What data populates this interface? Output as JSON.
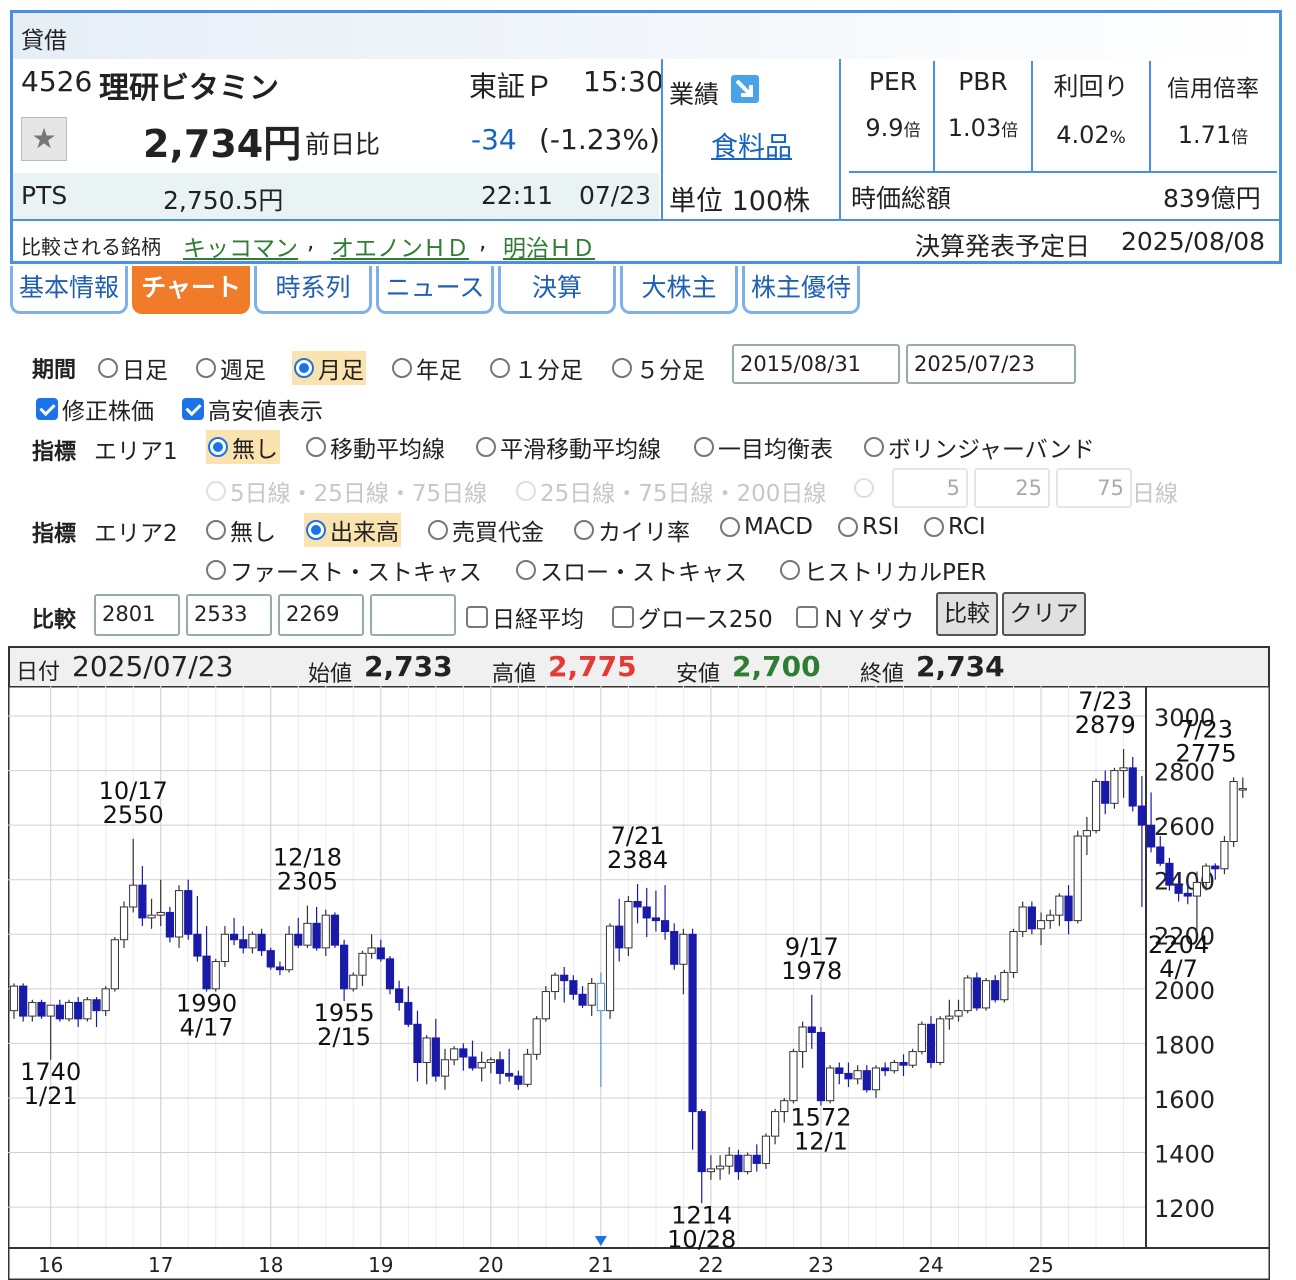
{
  "header": {
    "margin_label": "貸借",
    "code": "4526",
    "name": "理研ビタミン",
    "market": "東証Ｐ",
    "time": "15:30",
    "price": "2,734円",
    "change_label": "前日比",
    "change": "-34",
    "change_pct": "(-1.23%)",
    "pts_label": "PTS",
    "pts_price": "2,750.5円",
    "pts_time": "22:11",
    "pts_date": "07/23",
    "results_label": "業績",
    "sector": "食料品",
    "unit": "単位 100株",
    "metrics": [
      {
        "label": "PER",
        "value": "9.9",
        "unit": "倍"
      },
      {
        "label": "PBR",
        "value": "1.03",
        "unit": "倍"
      },
      {
        "label": "利回り",
        "value": "4.02",
        "unit": "%"
      },
      {
        "label": "信用倍率",
        "value": "1.71",
        "unit": "倍"
      }
    ],
    "market_cap_label": "時価総額",
    "market_cap": "839億円",
    "compare_label": "比較される銘柄",
    "compare_links": [
      "キッコマン",
      "オエノンＨＤ",
      "明治ＨＤ"
    ],
    "earnings_label": "決算発表予定日",
    "earnings_date": "2025/08/08"
  },
  "tabs": [
    "基本情報",
    "チャート",
    "時系列",
    "ニュース",
    "決算",
    "大株主",
    "株主優待"
  ],
  "active_tab": "チャート",
  "controls": {
    "period_label": "期間",
    "period_options": [
      "日足",
      "週足",
      "月足",
      "年足",
      "１分足",
      "５分足"
    ],
    "period_selected": "月足",
    "date_from": "2015/08/31",
    "date_to": "2025/07/23",
    "adjusted_label": "修正株価",
    "highlow_label": "高安値表示",
    "indicator_label": "指標",
    "area1_label": "エリア1",
    "area1_options": [
      "無し",
      "移動平均線",
      "平滑移動平均線",
      "一目均衡表",
      "ボリンジャーバンド"
    ],
    "area1_selected": "無し",
    "ma_options": [
      "5日線・25日線・75日線",
      "25日線・75日線・200日線"
    ],
    "ma_inputs": [
      "5",
      "25",
      "75"
    ],
    "ma_suffix": "日線",
    "area2_label": "エリア2",
    "area2_options": [
      "無し",
      "出来高",
      "売買代金",
      "カイリ率",
      "MACD",
      "RSI",
      "RCI",
      "ファースト・ストキャス",
      "スロー・ストキャス",
      "ヒストリカルPER"
    ],
    "area2_selected": "出来高",
    "compare_label": "比較",
    "compare_codes": [
      "2801",
      "2533",
      "2269",
      ""
    ],
    "compare_checks": [
      "日経平均",
      "グロース250",
      "ＮＹダウ"
    ],
    "compare_button": "比較",
    "clear_button": "クリア"
  },
  "ohlc_bar": {
    "date_label": "日付",
    "date": "2025/07/23",
    "open_label": "始値",
    "open": "2,733",
    "high_label": "高値",
    "high": "2,775",
    "low_label": "安値",
    "low": "2,700",
    "close_label": "終値",
    "close": "2,734"
  },
  "colors": {
    "up": "#ffffff",
    "down": "#1a1aa8",
    "high": "#e53935",
    "low": "#2e7d32",
    "accent": "#4a90e2",
    "tab_active": "#f07c2a"
  },
  "chart_data": {
    "type": "candlestick",
    "interval": "monthly",
    "ylim": [
      1050,
      3110
    ],
    "yticks": [
      1200,
      1400,
      1600,
      1800,
      2000,
      2200,
      2400,
      2600,
      2800,
      3000
    ],
    "xticks": [
      "16",
      "17",
      "18",
      "19",
      "20",
      "21",
      "22",
      "23",
      "24",
      "25"
    ],
    "year_start_index": 4,
    "candles": [
      [
        1920,
        2020,
        1890,
        2010
      ],
      [
        2010,
        2020,
        1880,
        1900
      ],
      [
        1900,
        1960,
        1880,
        1950
      ],
      [
        1950,
        1960,
        1890,
        1900
      ],
      [
        1900,
        1940,
        1740,
        1940
      ],
      [
        1940,
        1960,
        1880,
        1890
      ],
      [
        1890,
        1960,
        1880,
        1950
      ],
      [
        1950,
        1970,
        1860,
        1890
      ],
      [
        1890,
        1970,
        1880,
        1960
      ],
      [
        1960,
        1970,
        1860,
        1920
      ],
      [
        1920,
        2010,
        1900,
        2000
      ],
      [
        2000,
        2190,
        1990,
        2180
      ],
      [
        2180,
        2320,
        2150,
        2300
      ],
      [
        2300,
        2550,
        2280,
        2380
      ],
      [
        2380,
        2450,
        2230,
        2260
      ],
      [
        2260,
        2330,
        2220,
        2270
      ],
      [
        2270,
        2400,
        2230,
        2280
      ],
      [
        2280,
        2300,
        2170,
        2190
      ],
      [
        2190,
        2380,
        2150,
        2360
      ],
      [
        2360,
        2400,
        2180,
        2200
      ],
      [
        2200,
        2340,
        2100,
        2120
      ],
      [
        2120,
        2230,
        1990,
        2000
      ],
      [
        2000,
        2110,
        1990,
        2100
      ],
      [
        2100,
        2230,
        2080,
        2200
      ],
      [
        2200,
        2260,
        2160,
        2180
      ],
      [
        2180,
        2230,
        2130,
        2150
      ],
      [
        2150,
        2210,
        2130,
        2200
      ],
      [
        2200,
        2220,
        2120,
        2140
      ],
      [
        2140,
        2150,
        2070,
        2080
      ],
      [
        2080,
        2100,
        2050,
        2070
      ],
      [
        2070,
        2230,
        2060,
        2200
      ],
      [
        2200,
        2260,
        2150,
        2160
      ],
      [
        2160,
        2305,
        2150,
        2240
      ],
      [
        2240,
        2300,
        2140,
        2150
      ],
      [
        2150,
        2290,
        2120,
        2270
      ],
      [
        2270,
        2280,
        2150,
        2160
      ],
      [
        2160,
        2180,
        1955,
        2000
      ],
      [
        2000,
        2060,
        1990,
        2050
      ],
      [
        2050,
        2140,
        2010,
        2130
      ],
      [
        2130,
        2200,
        2110,
        2150
      ],
      [
        2150,
        2180,
        2100,
        2110
      ],
      [
        2110,
        2120,
        1980,
        2000
      ],
      [
        2000,
        2030,
        1920,
        1950
      ],
      [
        1950,
        2010,
        1860,
        1870
      ],
      [
        1870,
        1920,
        1660,
        1730
      ],
      [
        1730,
        1830,
        1650,
        1820
      ],
      [
        1820,
        1890,
        1660,
        1680
      ],
      [
        1680,
        1780,
        1630,
        1740
      ],
      [
        1740,
        1790,
        1720,
        1780
      ],
      [
        1780,
        1800,
        1700,
        1750
      ],
      [
        1750,
        1810,
        1700,
        1710
      ],
      [
        1710,
        1770,
        1660,
        1730
      ],
      [
        1730,
        1750,
        1690,
        1740
      ],
      [
        1740,
        1770,
        1650,
        1690
      ],
      [
        1690,
        1780,
        1660,
        1680
      ],
      [
        1680,
        1700,
        1630,
        1650
      ],
      [
        1650,
        1780,
        1640,
        1760
      ],
      [
        1760,
        1900,
        1740,
        1890
      ],
      [
        1890,
        2010,
        1880,
        1990
      ],
      [
        1990,
        2060,
        1960,
        2050
      ],
      [
        2050,
        2080,
        1950,
        2030
      ],
      [
        2030,
        2050,
        1960,
        1980
      ],
      [
        1980,
        2010,
        1930,
        1940
      ],
      [
        1940,
        2040,
        1900,
        2020
      ],
      [
        2020,
        2060,
        1640,
        1920
      ],
      [
        1920,
        2240,
        1890,
        2230
      ],
      [
        2230,
        2330,
        2100,
        2150
      ],
      [
        2150,
        2340,
        2120,
        2320
      ],
      [
        2320,
        2384,
        2240,
        2300
      ],
      [
        2300,
        2370,
        2190,
        2260
      ],
      [
        2260,
        2360,
        2210,
        2250
      ],
      [
        2250,
        2380,
        2180,
        2210
      ],
      [
        2210,
        2240,
        2070,
        2090
      ],
      [
        2090,
        2220,
        1980,
        2200
      ],
      [
        2200,
        2220,
        1410,
        1550
      ],
      [
        1550,
        1560,
        1214,
        1330
      ],
      [
        1330,
        1390,
        1300,
        1340
      ],
      [
        1340,
        1390,
        1300,
        1350
      ],
      [
        1350,
        1420,
        1320,
        1390
      ],
      [
        1390,
        1410,
        1300,
        1330
      ],
      [
        1330,
        1400,
        1320,
        1390
      ],
      [
        1390,
        1430,
        1330,
        1360
      ],
      [
        1360,
        1470,
        1340,
        1460
      ],
      [
        1460,
        1560,
        1430,
        1550
      ],
      [
        1550,
        1600,
        1510,
        1590
      ],
      [
        1590,
        1780,
        1580,
        1770
      ],
      [
        1770,
        1880,
        1710,
        1860
      ],
      [
        1860,
        1978,
        1780,
        1840
      ],
      [
        1840,
        1860,
        1572,
        1590
      ],
      [
        1590,
        1720,
        1580,
        1710
      ],
      [
        1710,
        1730,
        1650,
        1690
      ],
      [
        1690,
        1730,
        1640,
        1670
      ],
      [
        1670,
        1720,
        1650,
        1700
      ],
      [
        1700,
        1720,
        1620,
        1630
      ],
      [
        1630,
        1720,
        1600,
        1710
      ],
      [
        1710,
        1730,
        1680,
        1700
      ],
      [
        1700,
        1740,
        1690,
        1730
      ],
      [
        1730,
        1760,
        1680,
        1720
      ],
      [
        1720,
        1780,
        1710,
        1770
      ],
      [
        1770,
        1880,
        1760,
        1870
      ],
      [
        1870,
        1900,
        1710,
        1730
      ],
      [
        1730,
        1900,
        1720,
        1890
      ],
      [
        1890,
        1960,
        1850,
        1900
      ],
      [
        1900,
        1960,
        1880,
        1920
      ],
      [
        1920,
        2050,
        1910,
        2040
      ],
      [
        2040,
        2060,
        1920,
        1930
      ],
      [
        1930,
        2040,
        1920,
        2030
      ],
      [
        2030,
        2050,
        1950,
        1960
      ],
      [
        1960,
        2070,
        1950,
        2060
      ],
      [
        2060,
        2220,
        2040,
        2210
      ],
      [
        2210,
        2320,
        2190,
        2300
      ],
      [
        2300,
        2320,
        2200,
        2220
      ],
      [
        2220,
        2280,
        2160,
        2250
      ],
      [
        2250,
        2290,
        2220,
        2270
      ],
      [
        2270,
        2350,
        2230,
        2340
      ],
      [
        2340,
        2380,
        2200,
        2250
      ],
      [
        2250,
        2580,
        2240,
        2560
      ],
      [
        2560,
        2630,
        2490,
        2580
      ],
      [
        2580,
        2770,
        2570,
        2760
      ],
      [
        2760,
        2800,
        2640,
        2680
      ],
      [
        2680,
        2810,
        2660,
        2800
      ],
      [
        2800,
        2879,
        2700,
        2810
      ],
      [
        2810,
        2850,
        2650,
        2670
      ],
      [
        2670,
        2780,
        2300,
        2600
      ],
      [
        2600,
        2720,
        2500,
        2520
      ],
      [
        2520,
        2560,
        2450,
        2460
      ],
      [
        2460,
        2480,
        2360,
        2380
      ],
      [
        2380,
        2420,
        2320,
        2350
      ],
      [
        2350,
        2390,
        2310,
        2340
      ],
      [
        2340,
        2430,
        2204,
        2390
      ],
      [
        2390,
        2460,
        2360,
        2450
      ],
      [
        2450,
        2460,
        2400,
        2440
      ],
      [
        2440,
        2560,
        2420,
        2540
      ],
      [
        2540,
        2775,
        2520,
        2760
      ],
      [
        2733,
        2775,
        2700,
        2734
      ]
    ],
    "annotations": [
      {
        "label": [
          "1740",
          "1/21"
        ],
        "value": 1740,
        "index": 4,
        "side": "below"
      },
      {
        "label": [
          "10/17",
          "2550"
        ],
        "value": 2550,
        "index": 13,
        "side": "above"
      },
      {
        "label": [
          "1990",
          "4/17"
        ],
        "value": 1990,
        "index": 21,
        "side": "below"
      },
      {
        "label": [
          "12/18",
          "2305"
        ],
        "value": 2305,
        "index": 32,
        "side": "above"
      },
      {
        "label": [
          "1955",
          "2/15"
        ],
        "value": 1955,
        "index": 36,
        "side": "below"
      },
      {
        "label": [
          "7/21",
          "2384"
        ],
        "value": 2384,
        "index": 68,
        "side": "above"
      },
      {
        "label": [
          "1214",
          "10/28"
        ],
        "value": 1214,
        "index": 75,
        "side": "below"
      },
      {
        "label": [
          "9/17",
          "1978"
        ],
        "value": 1978,
        "index": 87,
        "side": "above"
      },
      {
        "label": [
          "1572",
          "12/1"
        ],
        "value": 1572,
        "index": 88,
        "side": "below"
      },
      {
        "label": [
          "7/23",
          "2879"
        ],
        "value": 2879,
        "index": 119,
        "side": "above"
      },
      {
        "label": [
          "7/23",
          "2775"
        ],
        "value": 2775,
        "index": 130,
        "side": "above"
      },
      {
        "label": [
          "2204",
          "4/7"
        ],
        "value": 2204,
        "index": 127,
        "side": "below"
      }
    ],
    "highlight_index": 64
  }
}
